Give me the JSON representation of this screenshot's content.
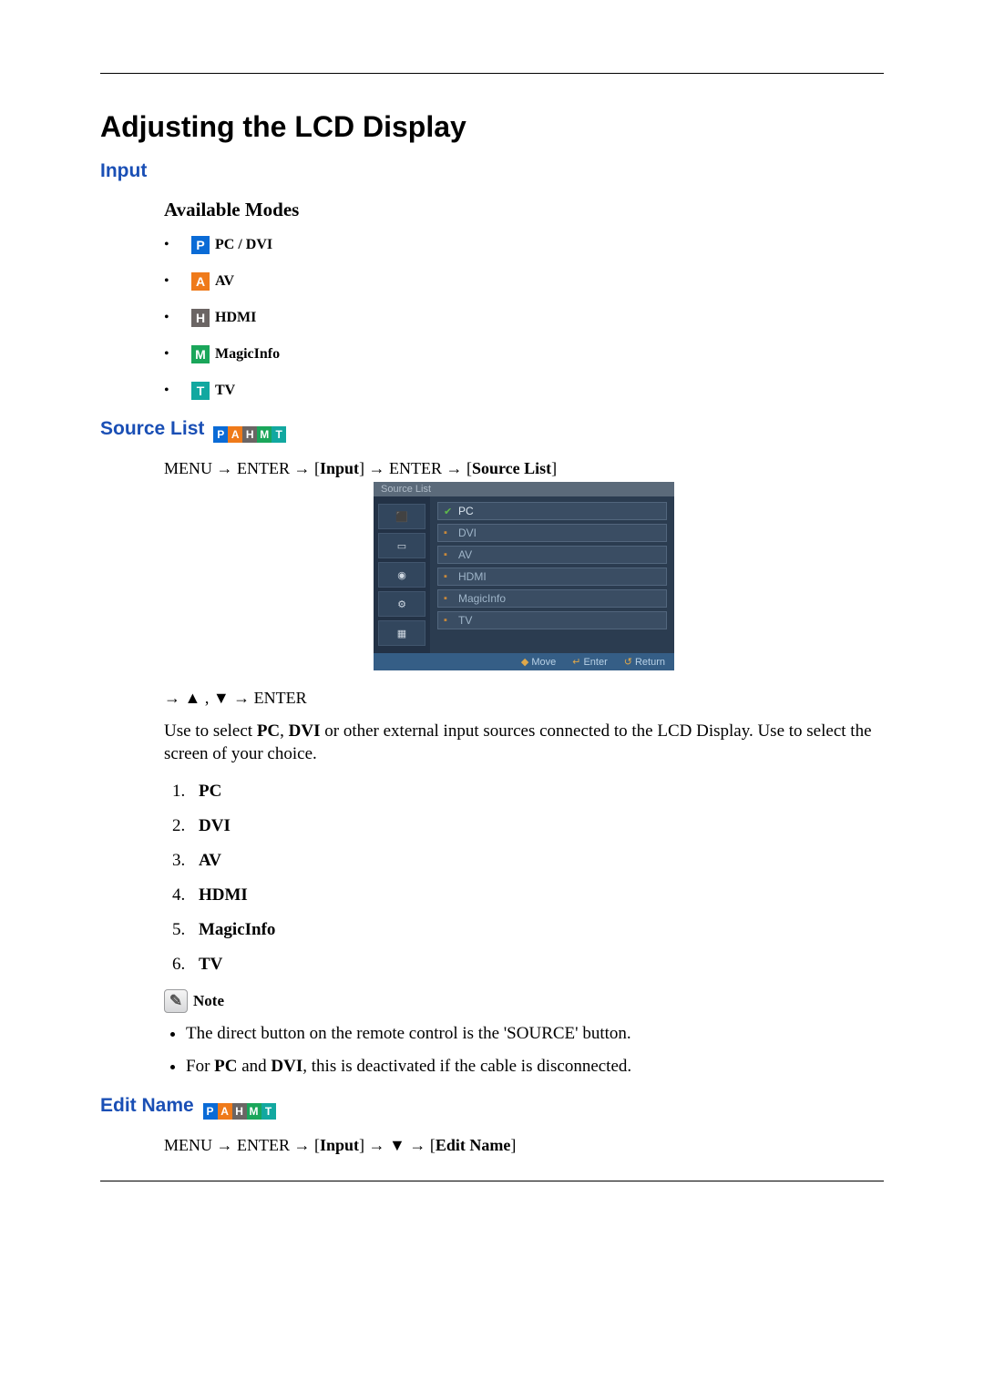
{
  "title": "Adjusting the LCD Display",
  "section_input": "Input",
  "avail_heading": "Available Modes",
  "modes": {
    "p_letter": "P",
    "p_label": "PC / DVI",
    "a_letter": "A",
    "a_label": "AV",
    "h_letter": "H",
    "h_label": "HDMI",
    "m_letter": "M",
    "m_label": "MagicInfo",
    "t_letter": "T",
    "t_label": "TV"
  },
  "section_source_list": "Source List",
  "path_source_list": {
    "p1": "MENU → ENTER → [",
    "b1": "Input",
    "p2": "] → ENTER → [",
    "b2": "Source List",
    "p3": "]"
  },
  "osd": {
    "header": "Source List",
    "items": [
      "PC",
      "DVI",
      "AV",
      "HDMI",
      "MagicInfo",
      "TV"
    ],
    "footer": {
      "move": "Move",
      "enter": "Enter",
      "return": "Return"
    }
  },
  "arrows_line": "→ ▲ , ▼ → ENTER",
  "body_para": {
    "t1": "Use to select ",
    "b1": "PC",
    "t2": ", ",
    "b2": "DVI",
    "t3": " or other external input sources connected to the LCD Display. Use to select the screen of your choice."
  },
  "sources_list": [
    "PC",
    "DVI",
    "AV",
    "HDMI",
    "MagicInfo",
    "TV"
  ],
  "note_label": "Note",
  "notes": {
    "n1": "The direct button on the remote control is the 'SOURCE' button.",
    "n2_a": "For ",
    "n2_b1": "PC",
    "n2_b": " and ",
    "n2_b2": "DVI",
    "n2_c": ", this is deactivated if the cable is disconnected."
  },
  "section_edit_name": "Edit Name",
  "path_edit_name": {
    "p1": "MENU → ENTER → [",
    "b1": "Input",
    "p2": "] → ▼ → [",
    "b2": "Edit Name",
    "p3": "]"
  }
}
